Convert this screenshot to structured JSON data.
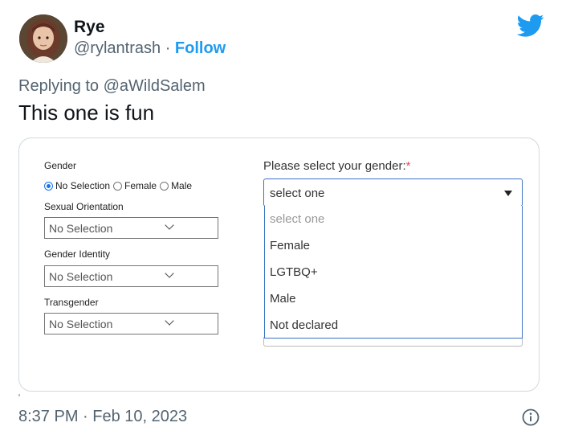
{
  "author": {
    "display_name": "Rye",
    "handle": "@rylantrash",
    "separator": "·",
    "follow_label": "Follow"
  },
  "reply": {
    "prefix": "Replying to",
    "mention": "@aWildSalem"
  },
  "tweet_text": "This one is fun",
  "form": {
    "gender_label": "Gender",
    "gender_options": [
      "No Selection",
      "Female",
      "Male"
    ],
    "gender_selected": "No Selection",
    "sexual_orientation_label": "Sexual Orientation",
    "sexual_orientation_value": "No Selection",
    "gender_identity_label": "Gender Identity",
    "gender_identity_value": "No Selection",
    "transgender_label": "Transgender",
    "transgender_value": "No Selection",
    "question_label": "Please select your gender:",
    "required_mark": "*",
    "dropdown_value": "select one",
    "dropdown_options": [
      "select one",
      "Female",
      "LGTBQ+",
      "Male",
      "Not declared"
    ]
  },
  "timestamp": {
    "time": "8:37 PM",
    "separator": "·",
    "date": "Feb 10, 2023"
  },
  "icons": {
    "bird": "twitter-bird-icon",
    "info": "info-icon"
  },
  "colors": {
    "accent": "#1d9bf0",
    "secondary_text": "#536471",
    "focus_border": "#3b73c2",
    "required": "#d9534f"
  }
}
